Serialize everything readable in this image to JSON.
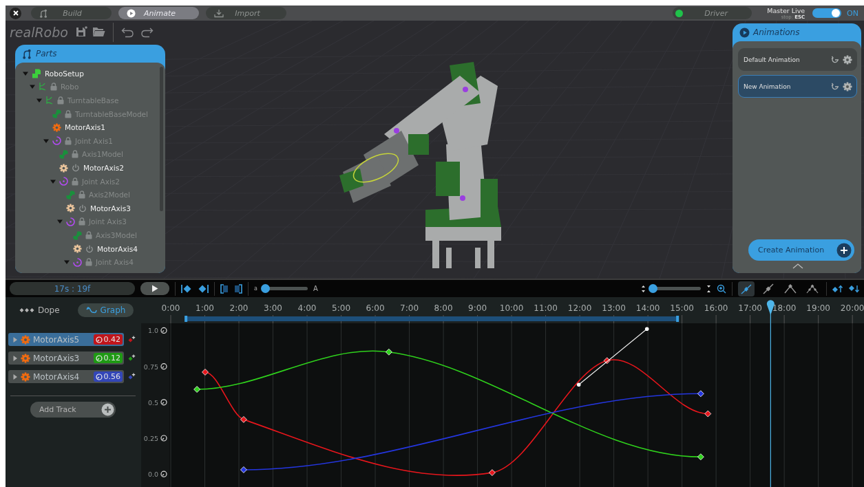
{
  "topbar": {
    "tabs": [
      {
        "label": "Build",
        "kind": "build",
        "selected": false
      },
      {
        "label": "Animate",
        "kind": "animate",
        "selected": true
      },
      {
        "label": "Import",
        "kind": "import",
        "selected": false
      }
    ],
    "driver": {
      "label": "Driver",
      "color": "#1fc24a"
    },
    "master_live": {
      "label": "Master Live",
      "hint_prefix": "stop:",
      "hint_key": "ESC",
      "on": true,
      "state_label": "ON"
    }
  },
  "project": {
    "name": "realRobo"
  },
  "parts_panel": {
    "title": "Parts",
    "tree": [
      {
        "label": "RoboSetup",
        "kind": "setup",
        "expanded": true,
        "locked": false,
        "children": [
          {
            "label": "Robo",
            "kind": "group",
            "expanded": true,
            "locked": true,
            "children": [
              {
                "label": "TurntableBase",
                "kind": "group",
                "expanded": true,
                "locked": true,
                "children": [
                  {
                    "label": "TurntableBaseModel",
                    "kind": "model",
                    "locked": true
                  },
                  {
                    "label": "MotorAxis1",
                    "kind": "motor",
                    "locked": false,
                    "power": false,
                    "color": "#f26b0f"
                  },
                  {
                    "label": "Joint Axis1",
                    "kind": "joint",
                    "expanded": true,
                    "locked": true,
                    "children": [
                      {
                        "label": "Axis1Model",
                        "kind": "model",
                        "locked": true
                      },
                      {
                        "label": "MotorAxis2",
                        "kind": "motor",
                        "locked": false,
                        "power": true,
                        "color": "#e9c39b"
                      },
                      {
                        "label": "Joint Axis2",
                        "kind": "joint",
                        "expanded": true,
                        "locked": true,
                        "children": [
                          {
                            "label": "Axis2Model",
                            "kind": "model",
                            "locked": true
                          },
                          {
                            "label": "MotorAxis3",
                            "kind": "motor",
                            "locked": false,
                            "power": true,
                            "color": "#e9c39b"
                          },
                          {
                            "label": "Joint Axis3",
                            "kind": "joint",
                            "expanded": true,
                            "locked": true,
                            "children": [
                              {
                                "label": "Axis3Model",
                                "kind": "model",
                                "locked": true
                              },
                              {
                                "label": "MotorAxis4",
                                "kind": "motor",
                                "locked": false,
                                "power": true,
                                "color": "#e9c39b"
                              },
                              {
                                "label": "Joint Axis4",
                                "kind": "joint",
                                "expanded": true,
                                "locked": true
                              }
                            ]
                          }
                        ]
                      }
                    ]
                  }
                ]
              }
            ]
          }
        ]
      }
    ]
  },
  "animations_panel": {
    "title": "Animations",
    "items": [
      {
        "name": "Default Animation",
        "selected": false
      },
      {
        "name": "New Animation",
        "selected": true
      }
    ],
    "create_button": "Create Animation"
  },
  "timeline_toolbar": {
    "time": "17s : 19f",
    "scale_slider": {
      "min_label": "a",
      "max_label": "A",
      "level": 0.05
    },
    "zoom_slider": {
      "level": 0.03
    },
    "tangent_modes": [
      {
        "kind": "auto",
        "selected": true
      },
      {
        "kind": "linear",
        "selected": false
      },
      {
        "kind": "broken",
        "selected": false
      },
      {
        "kind": "step",
        "selected": false
      }
    ]
  },
  "view_tabs": [
    {
      "label": "Dope",
      "kind": "dope",
      "selected": false
    },
    {
      "label": "Graph",
      "kind": "graph",
      "selected": true
    }
  ],
  "tracks": [
    {
      "name": "MotorAxis5",
      "value": "0.42",
      "color": "#c0151b",
      "selected": true
    },
    {
      "name": "MotorAxis3",
      "value": "0.12",
      "color": "#1f9a14",
      "selected": false
    },
    {
      "name": "MotorAxis4",
      "value": "0.56",
      "color": "#3346b8",
      "selected": false
    }
  ],
  "add_track": "Add Track",
  "graph": {
    "chart_data": {
      "type": "line",
      "xlim": [
        0,
        20.34
      ],
      "ylim": [
        -0.09,
        1.05
      ],
      "xticks": [
        {
          "value": 0,
          "label": "0:00"
        },
        {
          "value": 1,
          "label": "1:00"
        },
        {
          "value": 2,
          "label": "2:00"
        },
        {
          "value": 3,
          "label": "3:00"
        },
        {
          "value": 4,
          "label": "4:00"
        },
        {
          "value": 5,
          "label": "5:00"
        },
        {
          "value": 6,
          "label": "6:00"
        },
        {
          "value": 7,
          "label": "7:00"
        },
        {
          "value": 8,
          "label": "8:00"
        },
        {
          "value": 9,
          "label": "9:00"
        },
        {
          "value": 10,
          "label": "10:00"
        },
        {
          "value": 11,
          "label": "11:00"
        },
        {
          "value": 12,
          "label": "12:00"
        },
        {
          "value": 13,
          "label": "13:00"
        },
        {
          "value": 14,
          "label": "14:00"
        },
        {
          "value": 15,
          "label": "15:00"
        },
        {
          "value": 16,
          "label": "16:00"
        },
        {
          "value": 17,
          "label": "17:00"
        },
        {
          "value": 18,
          "label": "18:00"
        },
        {
          "value": 19,
          "label": "19:00"
        },
        {
          "value": 20,
          "label": "20:00"
        }
      ],
      "yticks": [
        {
          "value": 1,
          "label": "1.0"
        },
        {
          "value": 0.75,
          "label": "0.75"
        },
        {
          "value": 0.5,
          "label": "0.5"
        },
        {
          "value": 0.25,
          "label": "0.25"
        },
        {
          "value": 0,
          "label": "0.0"
        }
      ],
      "series": [
        {
          "color": "#e8161c",
          "marker": "diamond",
          "x": [
            1.01,
            2.14,
            9.43,
            12.8,
            15.76
          ],
          "values": [
            0.71,
            0.38,
            0.01,
            0.79,
            0.42
          ]
        },
        {
          "color": "#2fd21c",
          "marker": "diamond",
          "x": [
            0.77,
            6.4,
            15.55
          ],
          "values": [
            0.59,
            0.85,
            0.12
          ]
        },
        {
          "color": "#2436e0",
          "marker": "diamond",
          "x": [
            2.14,
            15.55
          ],
          "values": [
            0.03,
            0.56
          ]
        }
      ],
      "grid": true,
      "ref_lines": [
        {
          "axis": "x",
          "value": 17.6,
          "color": "#4fb6ea"
        }
      ]
    },
    "range_start": {
      "level": 0.02
    },
    "range_end": {
      "level": 0.733
    }
  }
}
